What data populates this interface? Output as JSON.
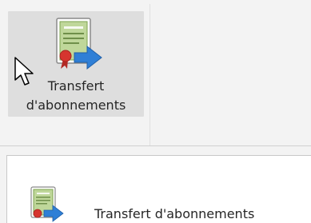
{
  "ribbon": {
    "button_label_line1": "Transfert",
    "button_label_line2": "d'abonnements",
    "icon": "certificate-transfer-icon"
  },
  "dropdown_menu": {
    "items": [
      {
        "label": "Transfert d'abonnements",
        "icon": "certificate-transfer-icon"
      }
    ]
  },
  "colors": {
    "ribbon_background": "#f3f3f3",
    "button_hover": "#dedede",
    "menu_background": "#ffffff",
    "arrow_blue": "#2f7fd6",
    "seal_red": "#d6352f",
    "certificate_green": "#bfd79a"
  }
}
